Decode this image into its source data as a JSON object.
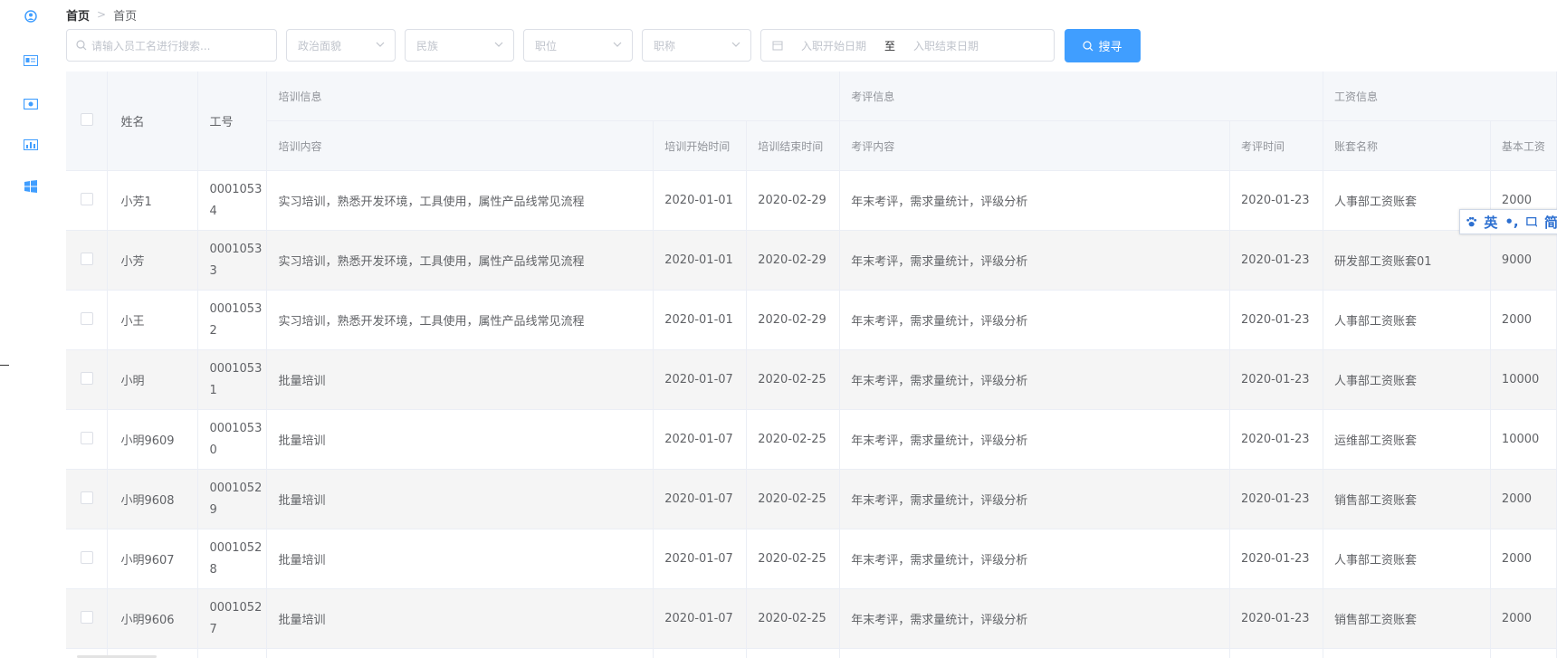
{
  "breadcrumb": {
    "home": "首页",
    "separator": ">",
    "current": "首页"
  },
  "filters": {
    "search_placeholder": "请输入员工名进行搜索...",
    "political": "政治面貌",
    "nation": "民族",
    "position": "职位",
    "title": "职称",
    "start_date": "入职开始日期",
    "date_sep": "至",
    "end_date": "入职结束日期",
    "search_button": "搜寻"
  },
  "table": {
    "group_headers": {
      "training": "培训信息",
      "appraisal": "考评信息",
      "salary": "工资信息"
    },
    "columns": {
      "name": "姓名",
      "empno": "工号",
      "train_content": "培训内容",
      "train_start": "培训开始时间",
      "train_end": "培训结束时间",
      "appraise_content": "考评内容",
      "appraise_time": "考评时间",
      "account_name": "账套名称",
      "base_salary": "基本工资"
    },
    "rows": [
      {
        "name": "小芳1",
        "empno": "00010534",
        "train_content": "实习培训，熟悉开发环境，工具使用，属性产品线常见流程",
        "train_start": "2020-01-01",
        "train_end": "2020-02-29",
        "appraise_content": "年末考评，需求量统计，评级分析",
        "appraise_time": "2020-01-23",
        "account": "人事部工资账套",
        "salary": "2000"
      },
      {
        "name": "小芳",
        "empno": "00010533",
        "train_content": "实习培训，熟悉开发环境，工具使用，属性产品线常见流程",
        "train_start": "2020-01-01",
        "train_end": "2020-02-29",
        "appraise_content": "年末考评，需求量统计，评级分析",
        "appraise_time": "2020-01-23",
        "account": "研发部工资账套01",
        "salary": "9000"
      },
      {
        "name": "小王",
        "empno": "00010532",
        "train_content": "实习培训，熟悉开发环境，工具使用，属性产品线常见流程",
        "train_start": "2020-01-01",
        "train_end": "2020-02-29",
        "appraise_content": "年末考评，需求量统计，评级分析",
        "appraise_time": "2020-01-23",
        "account": "人事部工资账套",
        "salary": "2000"
      },
      {
        "name": "小明",
        "empno": "00010531",
        "train_content": "批量培训",
        "train_start": "2020-01-07",
        "train_end": "2020-02-25",
        "appraise_content": "年末考评，需求量统计，评级分析",
        "appraise_time": "2020-01-23",
        "account": "人事部工资账套",
        "salary": "10000"
      },
      {
        "name": "小明9609",
        "empno": "00010530",
        "train_content": "批量培训",
        "train_start": "2020-01-07",
        "train_end": "2020-02-25",
        "appraise_content": "年末考评，需求量统计，评级分析",
        "appraise_time": "2020-01-23",
        "account": "运维部工资账套",
        "salary": "10000"
      },
      {
        "name": "小明9608",
        "empno": "00010529",
        "train_content": "批量培训",
        "train_start": "2020-01-07",
        "train_end": "2020-02-25",
        "appraise_content": "年末考评，需求量统计，评级分析",
        "appraise_time": "2020-01-23",
        "account": "销售部工资账套",
        "salary": "2000"
      },
      {
        "name": "小明9607",
        "empno": "00010528",
        "train_content": "批量培训",
        "train_start": "2020-01-07",
        "train_end": "2020-02-25",
        "appraise_content": "年末考评，需求量统计，评级分析",
        "appraise_time": "2020-01-23",
        "account": "人事部工资账套",
        "salary": "2000"
      },
      {
        "name": "小明9606",
        "empno": "00010527",
        "train_content": "批量培训",
        "train_start": "2020-01-07",
        "train_end": "2020-02-25",
        "appraise_content": "年末考评，需求量统计，评级分析",
        "appraise_time": "2020-01-23",
        "account": "销售部工资账套",
        "salary": "2000"
      }
    ]
  },
  "ime_toolbar": {
    "lang": "英",
    "punct": "•,",
    "mode": "简"
  },
  "colors": {
    "primary": "#409eff",
    "header_bg": "#f5f7fa",
    "border": "#ebeef5",
    "sidebar_icon": "#409eff"
  }
}
